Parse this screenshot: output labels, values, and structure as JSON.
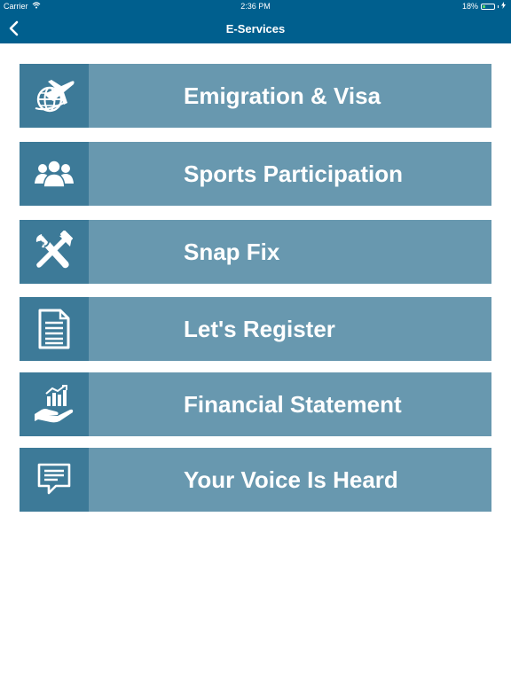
{
  "status_bar": {
    "carrier": "Carrier",
    "time": "2:36 PM",
    "battery": "18%"
  },
  "nav": {
    "title": "E-Services"
  },
  "menu": {
    "items": [
      {
        "label": "Emigration & Visa",
        "icon": "plane-globe-icon"
      },
      {
        "label": "Sports Participation",
        "icon": "people-group-icon"
      },
      {
        "label": "Snap Fix",
        "icon": "wrench-hammer-icon"
      },
      {
        "label": "Let's Register",
        "icon": "document-icon"
      },
      {
        "label": "Financial Statement",
        "icon": "hand-chart-icon"
      },
      {
        "label": "Your Voice Is Heard",
        "icon": "chat-bubble-icon"
      }
    ]
  },
  "colors": {
    "header": "#005f8e",
    "item_background": "#6898af",
    "icon_background": "#3d7a98",
    "text": "#ffffff"
  }
}
